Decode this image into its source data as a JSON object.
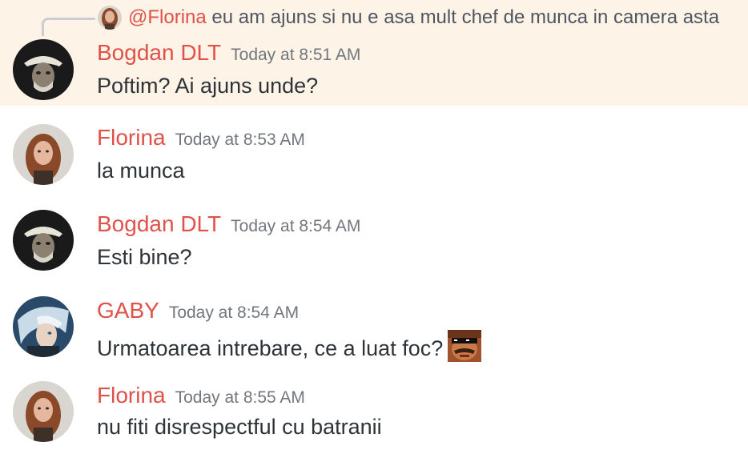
{
  "accent_color": "#e0514a",
  "highlight_color": "#fdf3e7",
  "messages": [
    {
      "author": "Bogdan DLT",
      "timestamp": "Today at 8:51 AM",
      "text": "Poftim? Ai ajuns unde?",
      "highlighted": true,
      "reply_to": {
        "author": "@Florina",
        "text": "eu am ajuns si nu e asa mult chef de munca in camera asta"
      }
    },
    {
      "author": "Florina",
      "timestamp": "Today at 8:53 AM",
      "text": "la munca"
    },
    {
      "author": "Bogdan DLT",
      "timestamp": "Today at 8:54 AM",
      "text": "Esti bine?"
    },
    {
      "author": "GABY",
      "timestamp": "Today at 8:54 AM",
      "text": "Urmatoarea intrebare, ce a luat foc?",
      "emoji": "deal-with-it-sunglasses-emoji"
    },
    {
      "author": "Florina",
      "timestamp": "Today at 8:55 AM",
      "text": "nu fiti disrespectful cu batranii"
    }
  ]
}
